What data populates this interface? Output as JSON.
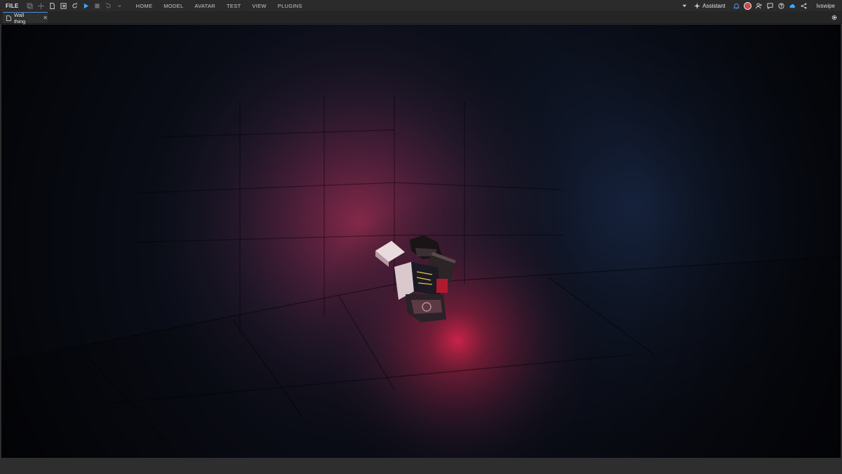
{
  "menubar": {
    "file_label": "FILE",
    "menus": [
      "HOME",
      "MODEL",
      "AVATAR",
      "TEST",
      "VIEW",
      "PLUGINS"
    ]
  },
  "toolbar_icons": [
    "copy-icon",
    "move-icon",
    "new-file-icon",
    "import-icon",
    "redo-icon",
    "play-icon",
    "stop-icon",
    "undo-icon",
    "dropdown-icon"
  ],
  "topright": {
    "assistant_label": "Assistant",
    "username": "lvswipe",
    "icons": [
      "dropdown-icon",
      "sparkle-icon",
      "notification-icon",
      "avatar",
      "add-friend-icon",
      "chat-icon",
      "help-icon",
      "cloud-icon",
      "share-icon"
    ]
  },
  "tabs": [
    {
      "label": "Wall thing",
      "close_label": "✕"
    }
  ],
  "colors": {
    "accent_blue": "#4a90e2",
    "spotlight_red": "#c8234a",
    "scene_dark": "#05070c"
  }
}
